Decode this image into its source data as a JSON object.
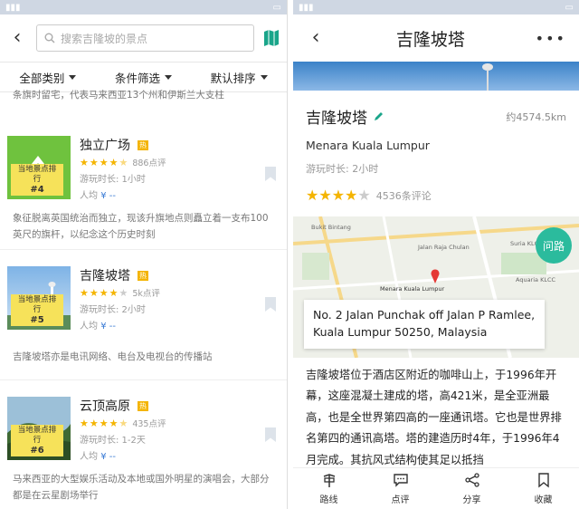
{
  "left": {
    "search_placeholder": "搜索吉隆坡的景点",
    "filters": [
      "全部类别",
      "条件筛选",
      "默认排序"
    ],
    "top_snippet": "条旗时留宅，代表马来西亚13个州和伊斯兰大支柱",
    "items": [
      {
        "name": "独立广场",
        "hot": "热",
        "rank_label": "当地景点排行",
        "rank": "#4",
        "reviews": "886点评",
        "duration": "游玩时长: 1小时",
        "price_label": "人均",
        "price": "¥ --",
        "stars": 4.5,
        "desc": "象征脱离英国统治而独立，现该升旗地点则矗立着一支布100英尺的旗杆，以纪念这个历史时刻"
      },
      {
        "name": "吉隆坡塔",
        "hot": "热",
        "rank_label": "当地景点排行",
        "rank": "#5",
        "reviews": "5k点评",
        "duration": "游玩时长: 2小时",
        "price_label": "人均",
        "price": "¥ --",
        "stars": 4,
        "desc": "吉隆坡塔亦是电讯网络、电台及电视台的传播站"
      },
      {
        "name": "云顶高原",
        "hot": "热",
        "rank_label": "当地景点排行",
        "rank": "#6",
        "reviews": "435点评",
        "duration": "游玩时长: 1-2天",
        "price_label": "人均",
        "price": "¥ --",
        "stars": 4.5,
        "desc": "马来西亚的大型娱乐活动及本地或国外明星的演唱会，大部分都是在云星剧场举行"
      }
    ]
  },
  "right": {
    "header_title": "吉隆坡塔",
    "title": "吉隆坡塔",
    "distance": "约4574.5km",
    "english_name": "Menara Kuala Lumpur",
    "duration": "游玩时长: 2小时",
    "stars": 4,
    "reviews": "4536条评论",
    "ask_label": "问路",
    "address": "No. 2 Jalan Punchak off Jalan P Ramlee, Kuala Lumpur 50250, Malaysia",
    "map_pin_label": "Menara Kuala Lumpur",
    "map_labels": [
      "Jalan Raja Chulan",
      "Suria KLCC",
      "Aquaria KLCC",
      "Bukit Bintang"
    ],
    "description": "吉隆坡塔位于酒店区附近的咖啡山上，于1996年开幕，这座混凝土建成的塔，高421米，是全亚洲最高，也是全世界第四高的一座通讯塔。它也是世界排名第四的通讯高塔。塔的建造历时4年，于1996年4月完成。其抗风式结构使其足以抵挡",
    "tabs": [
      "路线",
      "点评",
      "分享",
      "收藏"
    ]
  },
  "colors": {
    "accent": "#2bbb9d",
    "star": "#f4b400",
    "badge": "#f6e25a"
  }
}
